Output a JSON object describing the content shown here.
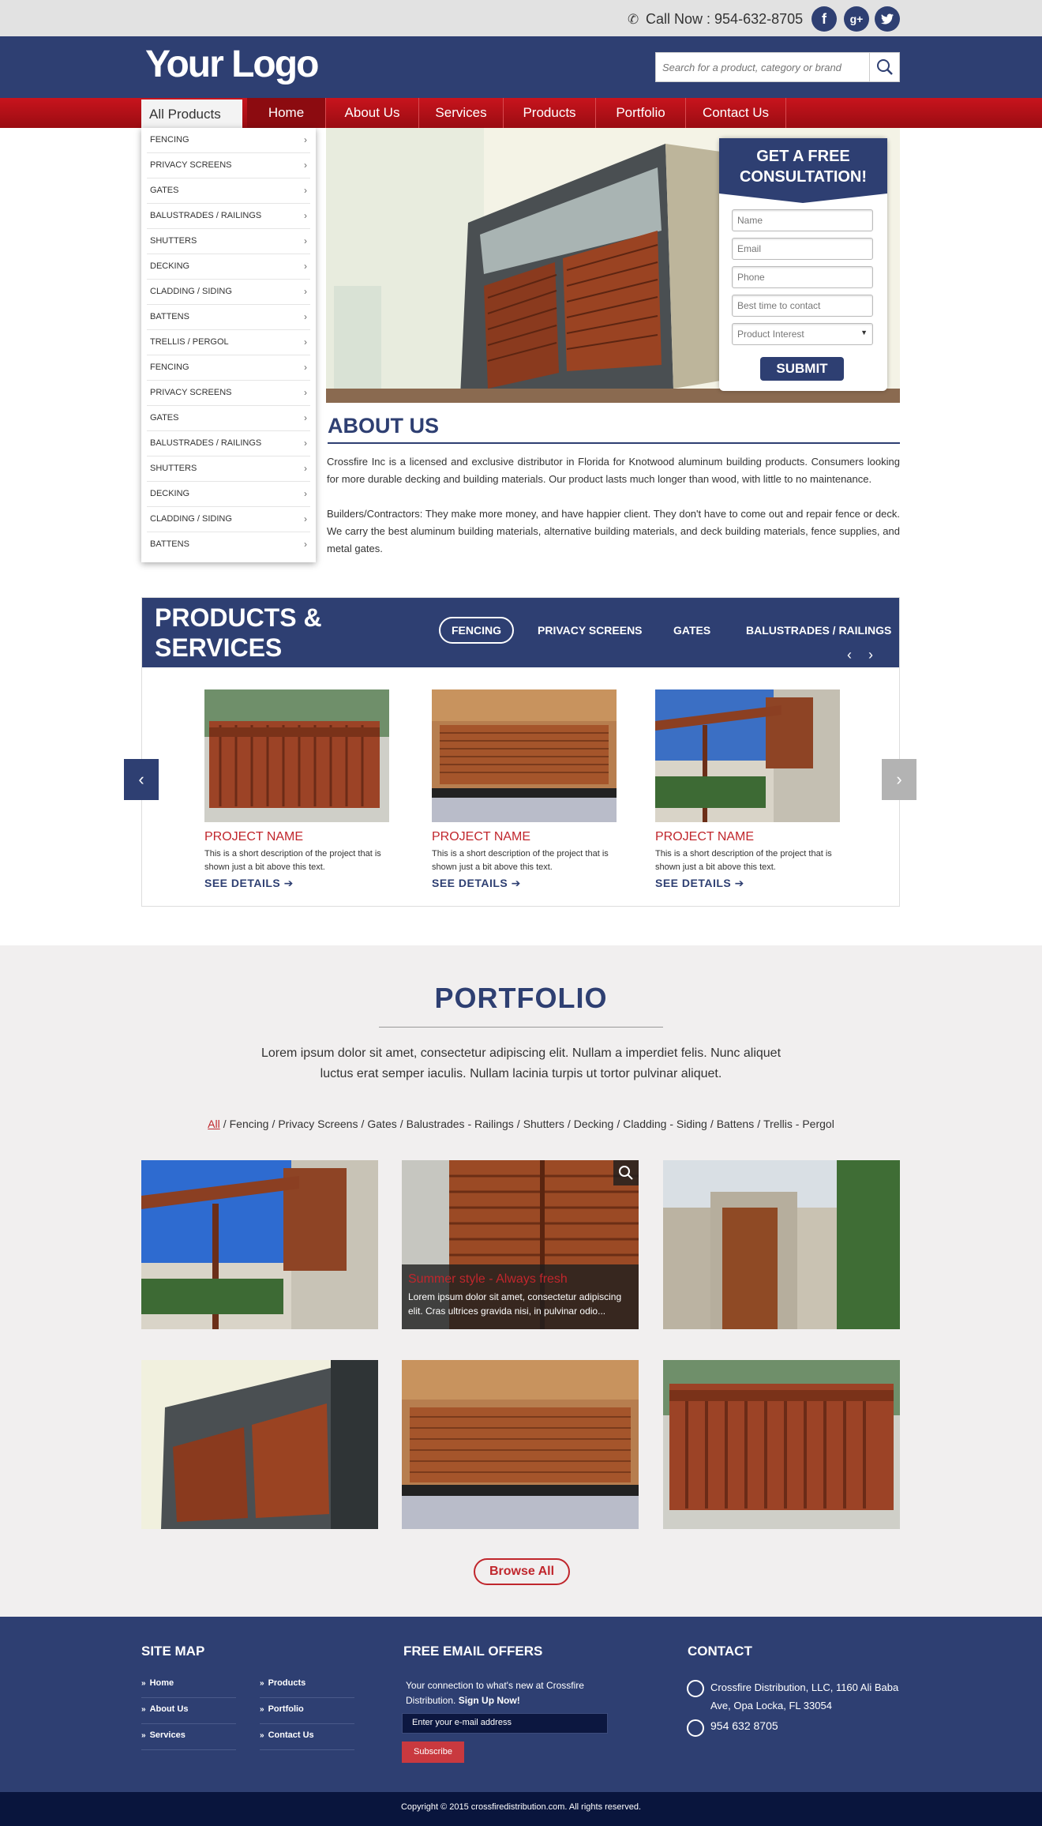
{
  "topbar": {
    "phone": "Call Now : 954-632-8705",
    "social": [
      "facebook-icon",
      "google-plus-icon",
      "twitter-icon"
    ]
  },
  "header": {
    "logo": "Your Logo",
    "search_placeholder": "Search for a product, category or brand"
  },
  "nav": {
    "all_products": "All Products",
    "items": [
      "Home",
      "About Us",
      "Services",
      "Products",
      "Portfolio",
      "Contact Us"
    ],
    "active": "Home"
  },
  "sidebar": {
    "items": [
      "FENCING",
      "PRIVACY SCREENS",
      "GATES",
      "BALUSTRADES / RAILINGS",
      "SHUTTERS",
      "DECKING",
      "CLADDING / SIDING",
      "BATTENS",
      "TRELLIS / PERGOL",
      "FENCING",
      "PRIVACY SCREENS",
      "GATES",
      "BALUSTRADES / RAILINGS",
      "SHUTTERS",
      "DECKING",
      "CLADDING / SIDING",
      "BATTENS"
    ]
  },
  "consult": {
    "title_line1": "GET A FREE",
    "title_line2": "CONSULTATION!",
    "fields": [
      "Name",
      "Email",
      "Phone",
      "Best time to contact"
    ],
    "select": "Product Interest",
    "submit": "SUBMIT"
  },
  "about": {
    "title": "ABOUT US",
    "p1": "Crossfire Inc is a licensed and exclusive distributor in Florida for Knotwood aluminum building products. Consumers looking for more durable decking and building materials.  Our product lasts much longer than wood, with little to no maintenance.",
    "p2": "Builders/Contractors:  They make more money, and have happier client.  They don't have to come out and repair fence or deck. We carry the best aluminum building materials, alternative building materials, and deck building materials, fence supplies, and metal gates."
  },
  "products": {
    "title_line1": "PRODUCTS &",
    "title_line2": "SERVICES",
    "tabs": [
      "FENCING",
      "PRIVACY SCREENS",
      "GATES",
      "BALUSTRADES / RAILINGS"
    ],
    "active_tab": "FENCING",
    "cards": [
      {
        "name": "PROJECT NAME",
        "desc": "This is a short description of the project that is shown just a bit above this text.",
        "link": "SEE DETAILS"
      },
      {
        "name": "PROJECT NAME",
        "desc": "This is a short description of the project that is shown just a bit above this text.",
        "link": "SEE DETAILS"
      },
      {
        "name": "PROJECT NAME",
        "desc": "This is a short description of the project that is shown just a bit above this text.",
        "link": "SEE DETAILS"
      }
    ]
  },
  "portfolio": {
    "title": "PORTFOLIO",
    "text": "Lorem ipsum dolor sit amet, consectetur adipiscing elit. Nullam a imperdiet felis. Nunc aliquet luctus erat semper iaculis. Nullam lacinia turpis ut tortor pulvinar aliquet.",
    "filters": [
      "All",
      "Fencing",
      "Privacy Screens",
      "Gates",
      "Balustrades - Railings",
      "Shutters",
      "Decking",
      "Cladding - Siding",
      "Battens",
      "Trellis - Pergol"
    ],
    "active_filter": "All",
    "overlay_title": "Summer style - Always fresh",
    "overlay_text": "Lorem ipsum dolor sit amet, consectetur adipiscing elit. Cras ultrices gravida nisi, in pulvinar odio...",
    "browse": "Browse All"
  },
  "footer": {
    "sitemap_title": "SITE MAP",
    "sitemap_col1": [
      "Home",
      "About Us",
      "Services"
    ],
    "sitemap_col2": [
      "Products",
      "Portfolio",
      "Contact Us"
    ],
    "email_title": "FREE EMAIL OFFERS",
    "email_text": "Your connection to what's new at Crossfire Distribution.",
    "email_signup": "Sign Up Now!",
    "email_placeholder": "Enter your e-mail address",
    "subscribe": "Subscribe",
    "contact_title": "CONTACT",
    "address": "Crossfire Distribution, LLC, 1160 Ali Baba Ave, Opa Locka, FL 33054",
    "phone": "954 632 8705",
    "copyright": "Copyright © 2015 crossfiredistribution.com. All rights reserved."
  },
  "colors": {
    "brand_blue": "#2e3f72",
    "brand_red": "#c0262c"
  }
}
